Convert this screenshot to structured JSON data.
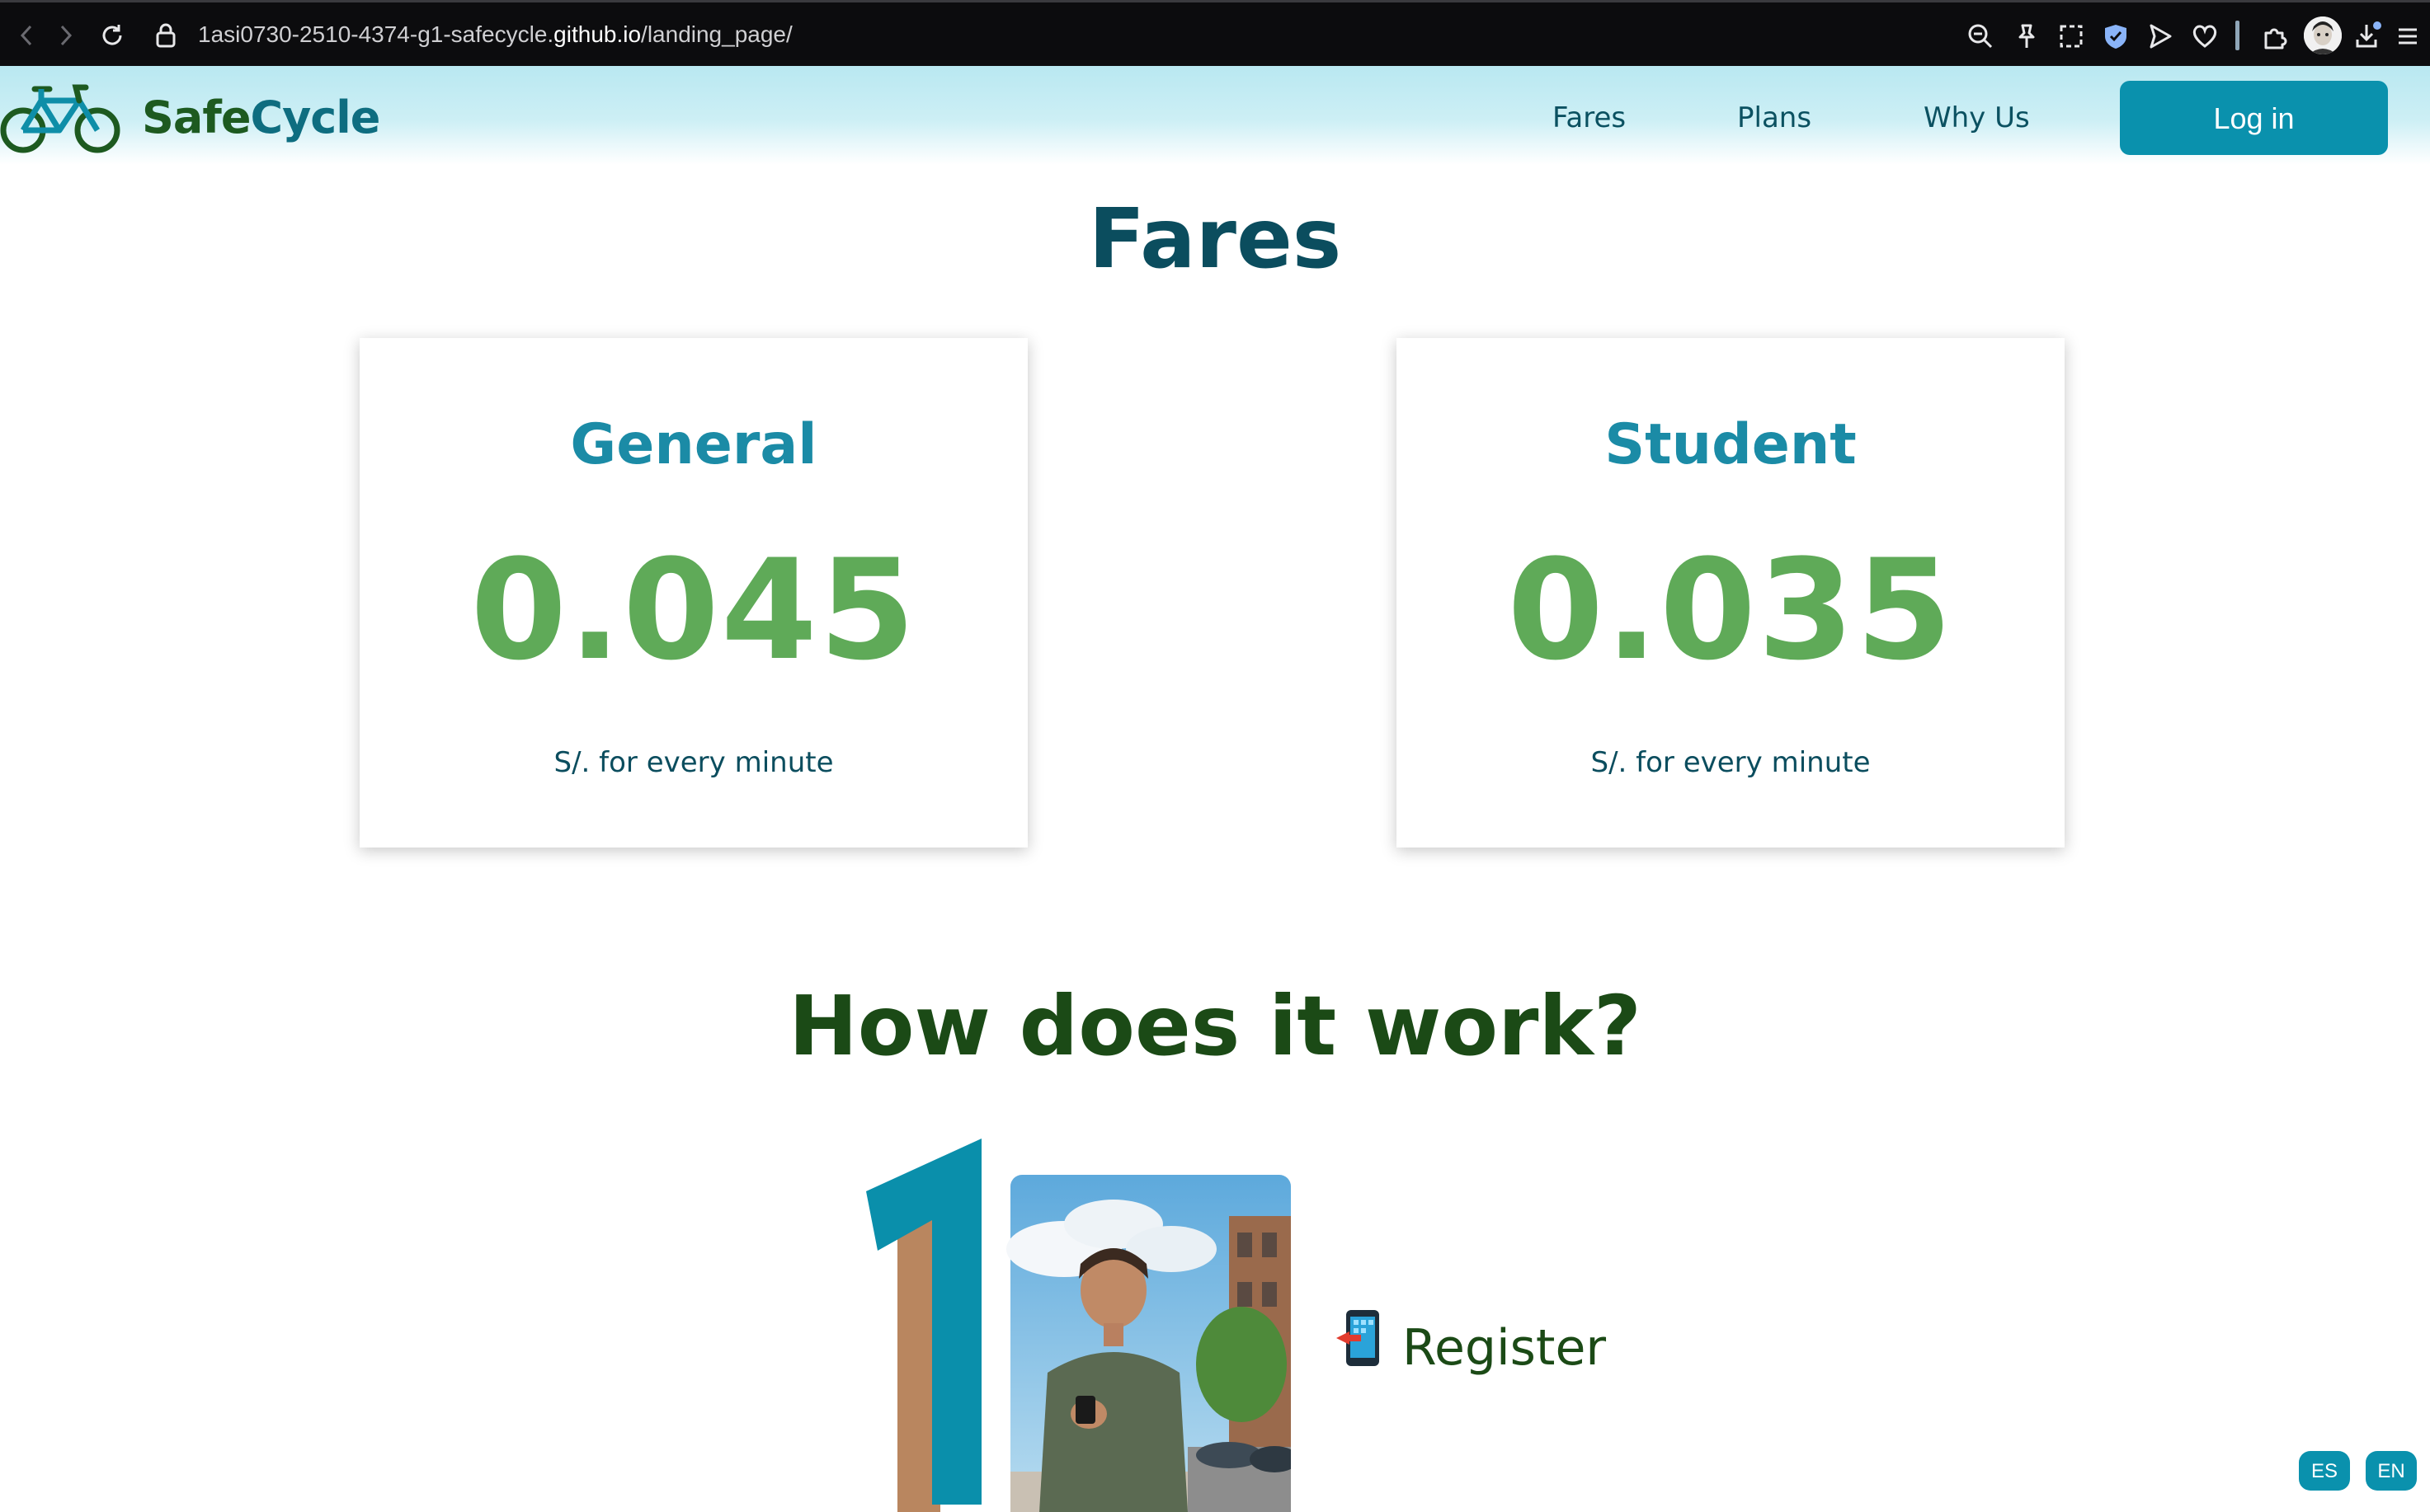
{
  "browser": {
    "url_prefix": "1asi0730-2510-4374-g1-safecycle.",
    "url_host": "github.io",
    "url_path": "/landing_page/"
  },
  "header": {
    "brand_part1": "Safe",
    "brand_part2": "Cycle",
    "nav": [
      "Fares",
      "Plans",
      "Why Us"
    ],
    "login_label": "Log in"
  },
  "fares": {
    "title": "Fares",
    "cards": [
      {
        "title": "General",
        "price": "0.045",
        "unit": "S/. for every minute"
      },
      {
        "title": "Student",
        "price": "0.035",
        "unit": "S/. for every minute"
      }
    ]
  },
  "how": {
    "title": "How does it work?",
    "steps": [
      {
        "number": "1",
        "label": "Register",
        "icon": "mobile-phone-arrow-icon"
      }
    ]
  },
  "languages": [
    "ES",
    "EN"
  ],
  "colors": {
    "brand_teal": "#0a91ad",
    "brand_green": "#1d5a20",
    "price_green": "#5faa58",
    "header_bg": "#b9e8f1"
  }
}
